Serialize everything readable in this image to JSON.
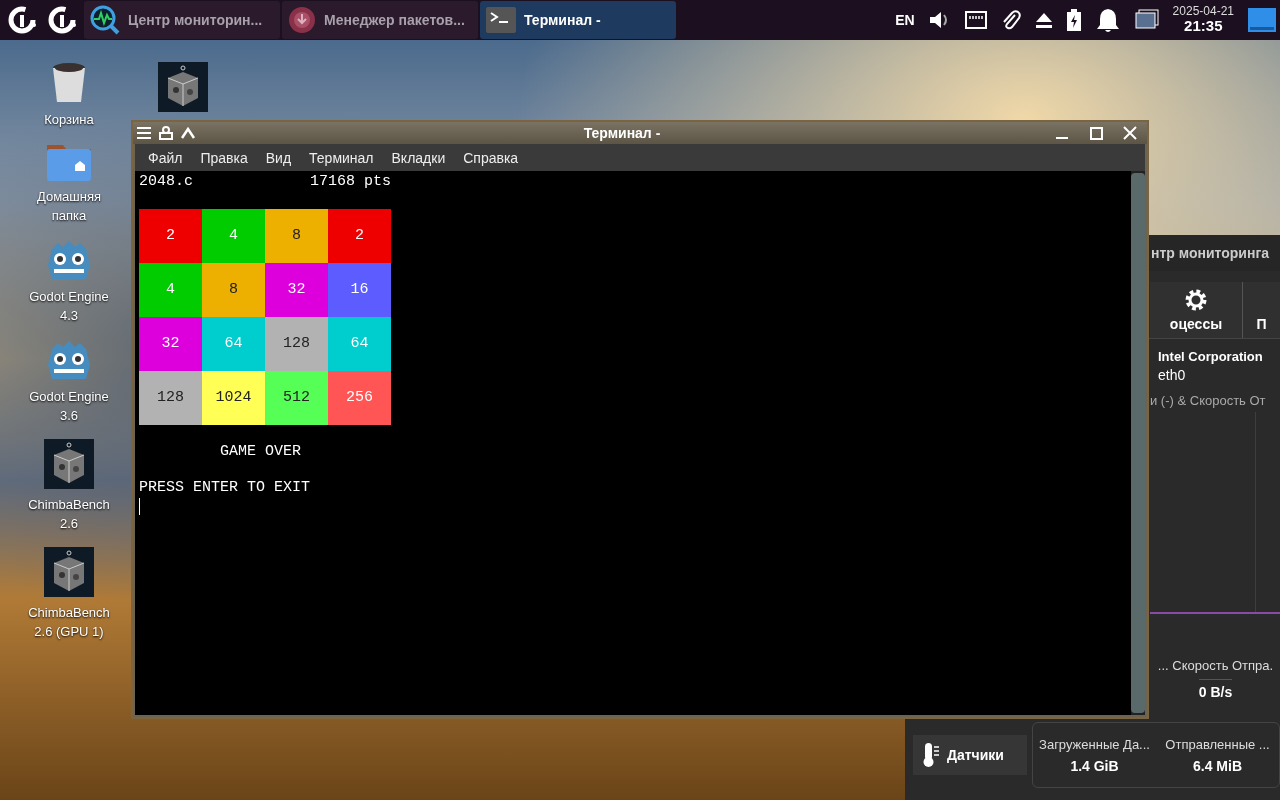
{
  "taskbar": {
    "launchers": [
      {
        "kind": "logo"
      },
      {
        "kind": "logo"
      }
    ],
    "tasks": [
      {
        "title": "Центр мониторин...",
        "kind": "monitor",
        "selected": false
      },
      {
        "title": "Менеджер пакетов...",
        "kind": "package",
        "selected": false
      },
      {
        "title": "Терминал -",
        "kind": "terminal",
        "selected": true
      }
    ],
    "language": "EN",
    "date": "2025-04-21",
    "time": "21:35"
  },
  "desktop_icons": [
    {
      "kind": "trash",
      "label": "Корзина"
    },
    {
      "kind": "folder",
      "label": "Домашняя папка"
    },
    {
      "kind": "godot",
      "label": "Godot Engine 4.3"
    },
    {
      "kind": "godot",
      "label": "Godot Engine 3.6"
    },
    {
      "kind": "cube",
      "label": "ChimbaBench 2.6"
    },
    {
      "kind": "cube",
      "label": "ChimbaBench 2.6 (GPU 1)"
    }
  ],
  "desktop_icons_column_2": [
    {
      "kind": "cube"
    }
  ],
  "monitor": {
    "title": "нтр мониторинга",
    "tabs": [
      {
        "label": "оцессы",
        "selected": false
      },
      {
        "label": "П",
        "selected": false
      }
    ],
    "device": "Intel Corporation",
    "interface": "eth0",
    "graph_legend": "и (-) & Скорость От",
    "upload_label": "... Скорость Отпра.",
    "upload_value": "0 B/s",
    "sidebar": [
      {
        "label": "Датчики",
        "selected": false
      }
    ],
    "totals": [
      {
        "label": "Загруженные Да...",
        "value": "1.4 GiB"
      },
      {
        "label": "Отправленные ...",
        "value": "6.4 MiB"
      }
    ]
  },
  "terminal": {
    "title": "Терминал -",
    "menu": [
      "Файл",
      "Правка",
      "Вид",
      "Терминал",
      "Вкладки",
      "Справка"
    ],
    "program": "2048.c",
    "score": "17168 pts",
    "board": [
      [
        {
          "value": "2",
          "color": "#ee0000"
        },
        {
          "value": "4",
          "color": "#00cc00"
        },
        {
          "value": "8",
          "color": "#eeb000"
        },
        {
          "value": "2",
          "color": "#ee0000"
        }
      ],
      [
        {
          "value": "4",
          "color": "#00cc00"
        },
        {
          "value": "8",
          "color": "#eeb000"
        },
        {
          "value": "32",
          "color": "#dd00dd"
        },
        {
          "value": "16",
          "color": "#5c5cff"
        }
      ],
      [
        {
          "value": "32",
          "color": "#dd00dd"
        },
        {
          "value": "64",
          "color": "#00cdcd"
        },
        {
          "value": "128",
          "color": "#b2b2b2"
        },
        {
          "value": "64",
          "color": "#00cdcd"
        }
      ],
      [
        {
          "value": "128",
          "color": "#b2b2b2"
        },
        {
          "value": "1024",
          "color": "#ffff55"
        },
        {
          "value": "512",
          "color": "#55ff55"
        },
        {
          "value": "256",
          "color": "#ff5555"
        }
      ]
    ],
    "message": "GAME OVER",
    "prompt": "PRESS ENTER TO EXIT"
  }
}
